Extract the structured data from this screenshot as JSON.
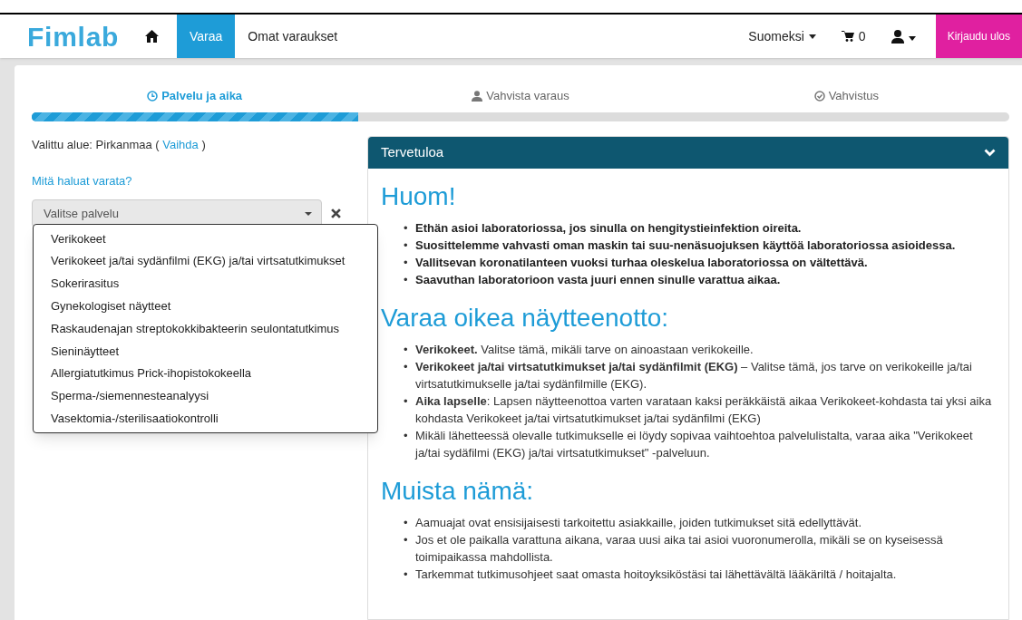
{
  "nav": {
    "logo": "Fimlab",
    "items": [
      {
        "label": "Varaa",
        "selected": true
      },
      {
        "label": "Omat varaukset",
        "selected": false
      }
    ],
    "language": "Suomeksi",
    "cart_count": "0",
    "logout": "Kirjaudu ulos"
  },
  "steps": [
    {
      "label": "Palvelu ja aika",
      "selected": true
    },
    {
      "label": "Vahvista varaus",
      "selected": false
    },
    {
      "label": "Vahvistus",
      "selected": false
    }
  ],
  "progress": {
    "level": 0.334
  },
  "region": {
    "prefix": "Valittu alue: Pirkanmaa ( ",
    "link": "Vaihda",
    "suffix": " )"
  },
  "question": "Mitä haluat varata?",
  "service_select": {
    "placeholder": "Valitse palvelu",
    "expanded": true,
    "options": [
      "Verikokeet",
      "Verikokeet ja/tai sydänfilmi (EKG) ja/tai virtsatutkimukset",
      "Sokerirasitus",
      "Gynekologiset näytteet",
      "Raskaudenajan streptokokkibakteerin seulontatutkimus",
      "Sieninäytteet",
      "Allergiatutkimus Prick-ihopistokokeella",
      "Sperma-/siemennesteanalyysi",
      "Vasektomia-/sterilisaatiokontrolli"
    ]
  },
  "panel": {
    "title": "Tervetuloa",
    "sections": [
      {
        "heading": "Huom!",
        "items": [
          {
            "bullet": "•",
            "text": "Ethän asioi laboratoriossa, jos sinulla on hengitystieinfektion oireita.",
            "bold": true
          },
          {
            "bullet": "•",
            "text": "Suosittelemme vahvasti oman maskin tai suu-nenäsuojuksen käyttöä laboratoriossa asioidessa.",
            "bold": true
          },
          {
            "bullet": "•",
            "text": "Vallitsevan koronatilanteen vuoksi turhaa oleskelua laboratoriossa on vältettävä.",
            "bold": true
          },
          {
            "bullet": "•",
            "text": "Saavuthan laboratorioon vasta juuri ennen sinulle varattua aikaa.",
            "bold": true
          }
        ]
      },
      {
        "heading": "Varaa oikea näytteenotto:",
        "items": [
          {
            "bullet": "•",
            "text": "**Verikokeet.** Valitse tämä, mikäli tarve on ainoastaan verikokeille.",
            "bold": false
          },
          {
            "bullet": "•",
            "text": "**Verikokeet ja/tai virtsatutkimukset ja/tai sydänfilmit (EKG)** – Valitse tämä, jos tarve on verikokeille ja/tai virtsatutkimukselle ja/tai sydänfilmille (EKG).",
            "bold": false
          },
          {
            "bullet": "•",
            "text": "**Aika lapselle**: Lapsen näytteenottoa varten varataan kaksi peräkkäistä aikaa Verikokeet-kohdasta tai yksi aika kohdasta Verikokeet ja/tai virtsatutkimukset ja/tai sydänfilmi (EKG)",
            "bold": false
          },
          {
            "bullet": "•",
            "text": "Mikäli lähetteessä olevalle tutkimukselle ei löydy sopivaa vaihtoehtoa palvelulistalta, varaa aika \"Verikokeet ja/tai sydäfilmi (EKG) ja/tai virtsatutkimukset\" -palveluun.",
            "bold": false
          }
        ]
      },
      {
        "heading": "Muista nämä:",
        "items": [
          {
            "bullet": "•",
            "text": "Aamuajat ovat ensisijaisesti tarkoitettu asiakkaille, joiden tutkimukset sitä edellyttävät.",
            "bold": false
          },
          {
            "bullet": "•",
            "text": "Jos et ole paikalla varattuna aikana, varaa uusi aika tai asioi vuoronumerolla, mikäli se on kyseisessä toimipaikassa mahdollista.",
            "bold": false
          },
          {
            "bullet": "•",
            "text": "Tarkemmat tutkimusohjeet saat omasta hoitoyksiköstäsi tai lähettävältä lääkäriltä / hoitajalta.",
            "bold": false
          }
        ]
      }
    ]
  }
}
